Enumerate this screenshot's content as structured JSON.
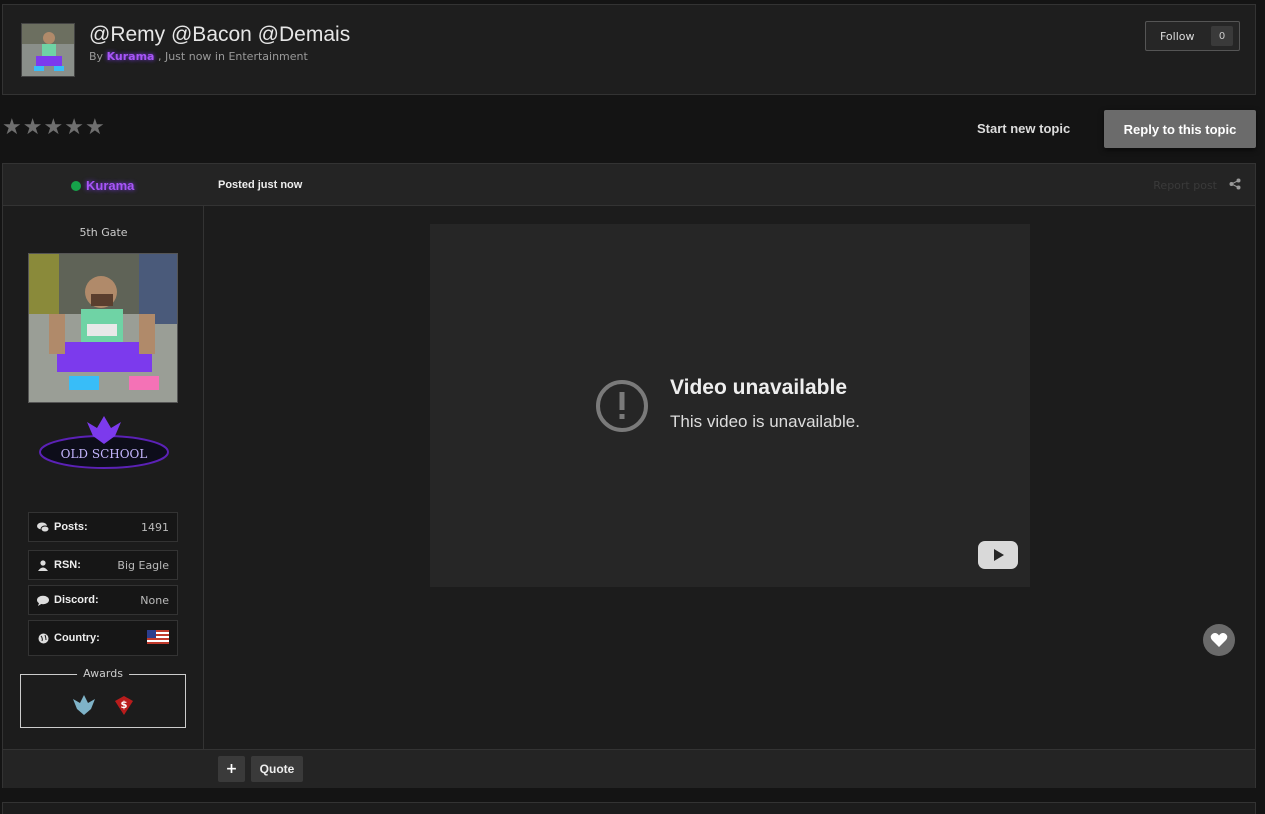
{
  "topic": {
    "title": "@Remy @Bacon @Demais",
    "by_label": "By",
    "author": "Kurama",
    "meta_suffix": ", Just now in Entertainment",
    "follow_label": "Follow",
    "follow_count": "0"
  },
  "rating": {
    "stars": 5,
    "filled": 0
  },
  "actions": {
    "start_new_topic": "Start new topic",
    "reply": "Reply to this topic"
  },
  "post": {
    "author": "Kurama",
    "posted": "Posted just now",
    "report": "Report post",
    "rank": "5th Gate",
    "badge_text": "OLD SCHOOL",
    "stats": [
      {
        "key": "Posts:",
        "value": "1491",
        "icon": "comments-icon"
      },
      {
        "key": "RSN:",
        "value": "Big Eagle",
        "icon": "user-icon"
      },
      {
        "key": "Discord:",
        "value": "None",
        "icon": "chat-icon"
      },
      {
        "key": "Country:",
        "value": "",
        "icon": "globe-icon"
      }
    ],
    "awards_label": "Awards",
    "video": {
      "title": "Video unavailable",
      "subtitle": "This video is unavailable."
    },
    "quote_label": "Quote",
    "plus_label": "+"
  },
  "colors": {
    "accent_username": "#a855f7",
    "online": "#16a34a",
    "background": "#141414"
  }
}
